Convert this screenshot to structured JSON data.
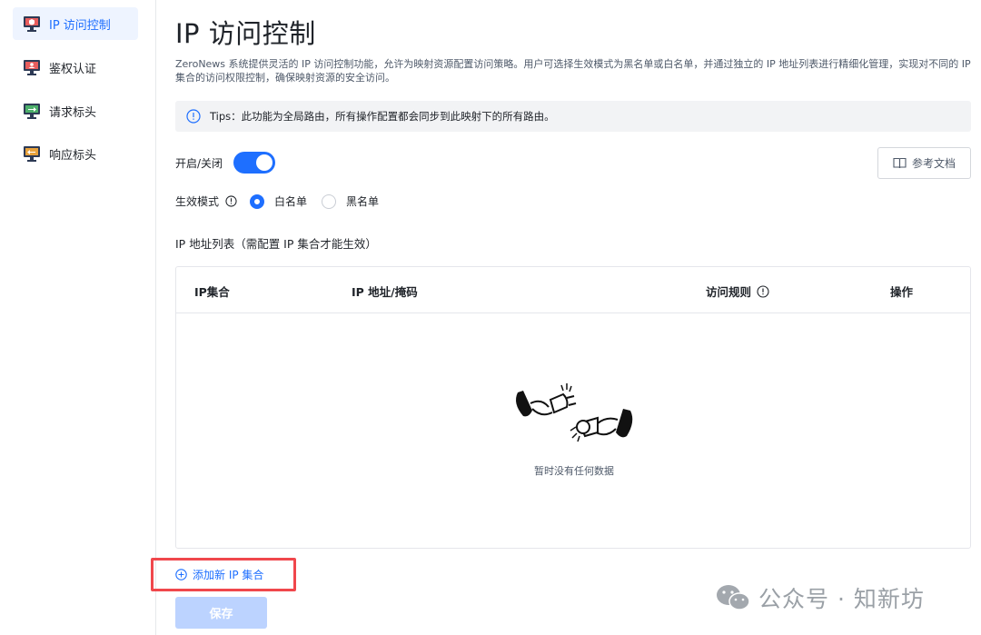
{
  "sidebar": {
    "items": [
      {
        "label": "IP 访问控制",
        "icon": "monitor-shield-icon",
        "active": true
      },
      {
        "label": "鉴权认证",
        "icon": "monitor-user-icon",
        "active": false
      },
      {
        "label": "请求标头",
        "icon": "monitor-arrow-icon",
        "active": false
      },
      {
        "label": "响应标头",
        "icon": "monitor-arrow-icon",
        "active": false
      }
    ]
  },
  "main": {
    "title": "IP 访问控制",
    "description": "ZeroNews 系统提供灵活的 IP 访问控制功能，允许为映射资源配置访问策略。用户可选择生效模式为黑名单或白名单，并通过独立的 IP 地址列表进行精细化管理，实现对不同的 IP 集合的访问权限控制，确保映射资源的安全访问。",
    "tips": "Tips：此功能为全局路由，所有操作配置都会同步到此映射下的所有路由。",
    "switch_label": "开启/关闭",
    "switch_on": true,
    "doc_button": "参考文档",
    "mode_label": "生效模式",
    "mode_options": [
      {
        "label": "白名单",
        "checked": true
      },
      {
        "label": "黑名单",
        "checked": false
      }
    ],
    "list_title": "IP 地址列表（需配置 IP 集合才能生效）",
    "table": {
      "columns": [
        "IP集合",
        "IP 地址/掩码",
        "访问规则",
        "操作"
      ],
      "rows": [],
      "empty_text": "暂时没有任何数据"
    },
    "add_link": "添加新 IP 集合",
    "save_button": "保存"
  },
  "watermark": "公众号 · 知新坊",
  "colors": {
    "accent": "#1e6fff",
    "active_bg": "#eef4ff",
    "highlight": "#f0474c",
    "save_disabled": "#bcd3ff"
  }
}
